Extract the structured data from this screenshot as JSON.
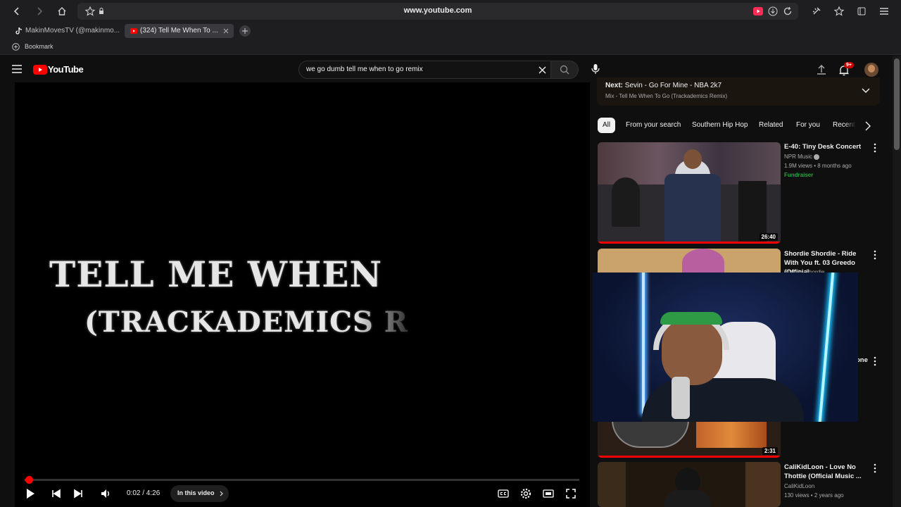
{
  "browser": {
    "url": "www.youtube.com",
    "tabs": [
      {
        "title": "MakinMovesTV (@makinmo...",
        "active": false
      },
      {
        "title": "(324) Tell Me When To ...",
        "active": true
      }
    ],
    "bookmark_label": "Bookmark"
  },
  "youtube": {
    "logo_text": "YouTube",
    "search": {
      "value": "we go dumb tell me when to go remix"
    },
    "notifications_badge": "9+"
  },
  "player": {
    "overlay_line1": "TELL ME WHEN",
    "overlay_line2": "(TRACKADEMICS R",
    "time": "0:02 / 4:26",
    "progress": 0.008,
    "chapters_label": "In this video"
  },
  "up_next": {
    "label": "Next:",
    "title": "Sevin - Go For Mine - NBA 2k7",
    "mix": "Mix - Tell Me When To Go (Trackademics Remix)"
  },
  "chips": [
    "All",
    "From your search",
    "Southern Hip Hop",
    "Related",
    "For you",
    "Recent"
  ],
  "recommendations": [
    {
      "title": "E-40: Tiny Desk Concert",
      "channel": "NPR Music",
      "meta": "1.9M views • 8 months ago",
      "badge": "Fundraiser",
      "duration": "26:40"
    },
    {
      "title": "Shordie Shordie - Ride With You ft. 03 Greedo (Official ...",
      "channel": "Shordie Shordie",
      "meta": "",
      "badge": "",
      "duration": ""
    },
    {
      "title": "...one",
      "channel": "",
      "meta": "",
      "badge": "",
      "duration": "2:31"
    },
    {
      "title": "CaliKidLoon - Love No Thottie (Official Music ...",
      "channel": "CaliKidLoon",
      "meta": "130 views • 2 years ago",
      "badge": "",
      "duration": ""
    }
  ],
  "colors": {
    "accent": "#ff0000",
    "badge_green": "#3ea6ff",
    "fundraiser": "#2ba640"
  }
}
